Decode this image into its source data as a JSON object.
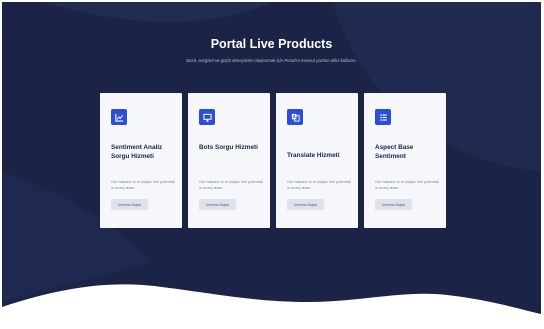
{
  "header": {
    "title": "Portal Live Products",
    "subtitle": "Basit, sezgisel ve güçlü deneyimler oluşturmak için Portal'ın mevcut yazılım dilini kullanın."
  },
  "colors": {
    "background": "#1b2447",
    "card": "#f6f7fb",
    "accent": "#2d4fd6",
    "button": "#dfe2ea"
  },
  "cards": [
    {
      "icon": "chart-icon",
      "title": "Sentiment Analiz Sorgu Hizmeti",
      "description": "Our mission is to ulaşılır the potential in every team.",
      "button_label": "Ücretsiz Başlat"
    },
    {
      "icon": "monitor-icon",
      "title": "Bots Sorgu Hizmeti",
      "description": "Our mission is to ulaşılır the potential in every team.",
      "button_label": "Ücretsiz Başlat"
    },
    {
      "icon": "translate-icon",
      "title": "Translate Hizmeti",
      "description": "Our mission is to ulaşılır the potential in every team.",
      "button_label": "Ücretsiz Başlat"
    },
    {
      "icon": "list-icon",
      "title": "Aspect Base Sentiment",
      "description": "Our mission is to ulaşılır the potential in every team.",
      "button_label": "Ücretsiz Başlat"
    }
  ]
}
